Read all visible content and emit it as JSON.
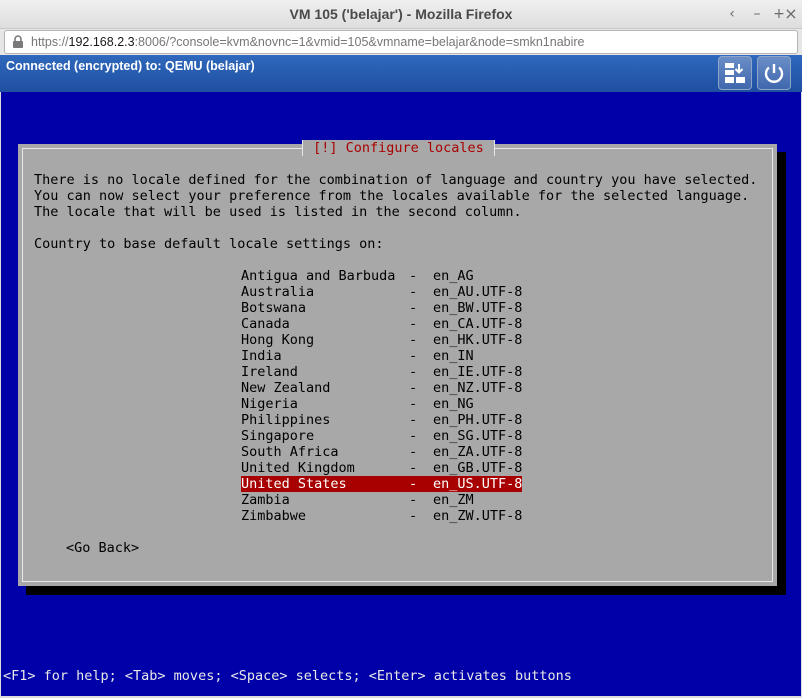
{
  "window": {
    "title": "VM 105 ('belajar') - Mozilla Firefox",
    "controls": [
      "‹",
      "–",
      "+",
      "×"
    ]
  },
  "browser": {
    "url_scheme": "https://",
    "url_host": "192.168.2.3",
    "url_rest": ":8006/?console=kvm&novnc=1&vmid=105&vmname=belajar&node=smkn1nabire"
  },
  "vnc": {
    "status": "Connected (encrypted) to: QEMU (belajar)",
    "accent": "#2f68bd"
  },
  "console": {
    "dialog_title": " [!] Configure locales ",
    "message_lines": [
      "There is no locale defined for the combination of language and country you have selected.",
      "You can now select your preference from the locales available for the selected language.",
      "The locale that will be used is listed in the second column."
    ],
    "prompt": "Country to base default locale settings on:",
    "separator": "-",
    "options": [
      {
        "country": "Antigua and Barbuda",
        "locale": "en_AG"
      },
      {
        "country": "Australia",
        "locale": "en_AU.UTF-8"
      },
      {
        "country": "Botswana",
        "locale": "en_BW.UTF-8"
      },
      {
        "country": "Canada",
        "locale": "en_CA.UTF-8"
      },
      {
        "country": "Hong Kong",
        "locale": "en_HK.UTF-8"
      },
      {
        "country": "India",
        "locale": "en_IN"
      },
      {
        "country": "Ireland",
        "locale": "en_IE.UTF-8"
      },
      {
        "country": "New Zealand",
        "locale": "en_NZ.UTF-8"
      },
      {
        "country": "Nigeria",
        "locale": "en_NG"
      },
      {
        "country": "Philippines",
        "locale": "en_PH.UTF-8"
      },
      {
        "country": "Singapore",
        "locale": "en_SG.UTF-8"
      },
      {
        "country": "South Africa",
        "locale": "en_ZA.UTF-8"
      },
      {
        "country": "United Kingdom",
        "locale": "en_GB.UTF-8"
      },
      {
        "country": "United States",
        "locale": "en_US.UTF-8"
      },
      {
        "country": "Zambia",
        "locale": "en_ZM"
      },
      {
        "country": "Zimbabwe",
        "locale": "en_ZW.UTF-8"
      }
    ],
    "selected_index": 13,
    "go_back": "<Go Back>",
    "help_line": "<F1> for help; <Tab> moves; <Space> selects; <Enter> activates buttons",
    "colors": {
      "background": "#0000a8",
      "dialog": "#a8a8a8",
      "highlight": "#a80000"
    }
  }
}
